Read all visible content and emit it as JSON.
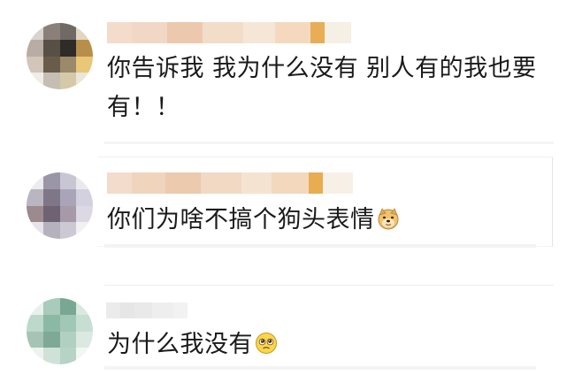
{
  "comments": [
    {
      "text_line1": "你告诉我 我为什么没有 别人有的我也要",
      "text_line2": "有！！"
    },
    {
      "text": "你们为啥不搞个狗头表情",
      "emoji": "doge-face"
    },
    {
      "text": "为什么我没有",
      "emoji": "pleading-face"
    }
  ],
  "colors": {
    "avatar1": [
      "#d8d4d2",
      "#8b8079",
      "#6f6a66",
      "#e3d6c0",
      "#b8aca4",
      "#585045",
      "#2f2b27",
      "#b88f4a",
      "#d2c5b9",
      "#6a5c4a",
      "#9a8a6a",
      "#e8c778",
      "#f0ece8",
      "#c7beb3",
      "#d4c9a8",
      "#ece6d8"
    ],
    "avatar2": [
      "#ecebee",
      "#9a95a7",
      "#c9c6d3",
      "#eaeaee",
      "#b9b5c1",
      "#7f7787",
      "#a9a4b8",
      "#d3d0df",
      "#9c8a8f",
      "#6f6272",
      "#a69aa8",
      "#dcd8e4",
      "#e6e4ea",
      "#b7b1bd",
      "#cdc9d4",
      "#f1f0f3"
    ],
    "avatar3": [
      "#e8f1ec",
      "#a8cbbb",
      "#78a893",
      "#d9e8e0",
      "#bcd9cc",
      "#8cb9a4",
      "#a1c7b5",
      "#c7dfd3",
      "#a5c4b6",
      "#7ea997",
      "#b2d0c2",
      "#dce9e2",
      "#edf4f0",
      "#cfe2d8",
      "#b7d3c5",
      "#f1f7f3"
    ],
    "name1": [
      "#f3dccb",
      "#f1d8c6",
      "#ecc9ae",
      "#f2ddc9",
      "#f5e6d6",
      "#f4d9bf",
      "#e8ad55",
      "#f6efe4"
    ],
    "name2": [
      "#f3dccb",
      "#f0d4bc",
      "#eccaad",
      "#f1d9c3",
      "#f5e3d1",
      "#f3d8bd",
      "#e9ac51",
      "#f7f0e6"
    ],
    "name3": [
      "#ecebec",
      "#e6e6e7",
      "#e9e9ea",
      "#eeeeef",
      "#f2f2f3"
    ]
  }
}
